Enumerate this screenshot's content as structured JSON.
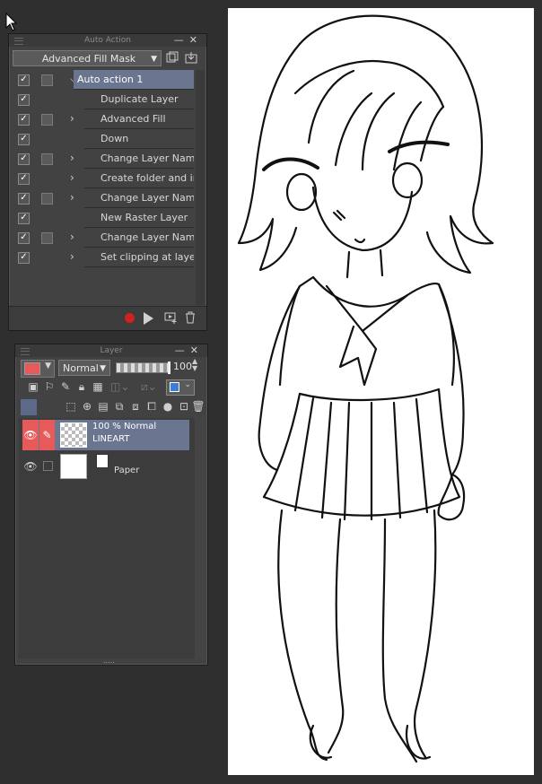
{
  "auto_action": {
    "title": "Auto Action",
    "set_name": "Advanced Fill Mask",
    "items": [
      {
        "label": "Auto action 1",
        "checked": true,
        "has_box": true,
        "chevron": "down",
        "selected": true,
        "indent": false
      },
      {
        "label": "Duplicate Layer",
        "checked": true,
        "has_box": false,
        "chevron": "",
        "selected": false,
        "indent": true
      },
      {
        "label": "Advanced Fill",
        "checked": true,
        "has_box": true,
        "chevron": "right",
        "selected": false,
        "indent": false
      },
      {
        "label": "Down",
        "checked": true,
        "has_box": false,
        "chevron": "",
        "selected": false,
        "indent": false
      },
      {
        "label": "Change Layer Name",
        "checked": true,
        "has_box": true,
        "chevron": "right",
        "selected": false,
        "indent": false
      },
      {
        "label": "Create folder and insert l",
        "checked": true,
        "has_box": false,
        "chevron": "right",
        "selected": false,
        "indent": false
      },
      {
        "label": "Change Layer Name",
        "checked": true,
        "has_box": true,
        "chevron": "right",
        "selected": false,
        "indent": false
      },
      {
        "label": "New Raster Layer",
        "checked": true,
        "has_box": false,
        "chevron": "",
        "selected": false,
        "indent": true
      },
      {
        "label": "Change Layer Name",
        "checked": true,
        "has_box": true,
        "chevron": "right",
        "selected": false,
        "indent": false
      },
      {
        "label": "Set clipping at layer belo",
        "checked": true,
        "has_box": false,
        "chevron": "right",
        "selected": false,
        "indent": false
      }
    ]
  },
  "layer": {
    "title": "Layer",
    "color_hex": "#e65a5a",
    "blend_mode": "Normal",
    "opacity": "100",
    "layers": [
      {
        "line1": "100 % Normal",
        "line2": "LINEART",
        "selected": true,
        "thumb": "transparent"
      },
      {
        "line1": "",
        "line2": "Paper",
        "selected": false,
        "thumb": "white"
      }
    ],
    "footer_dots": "....."
  },
  "colors": {
    "accent": "#6a7590",
    "record": "#d02020",
    "layer_edit": "#e65a5a"
  }
}
